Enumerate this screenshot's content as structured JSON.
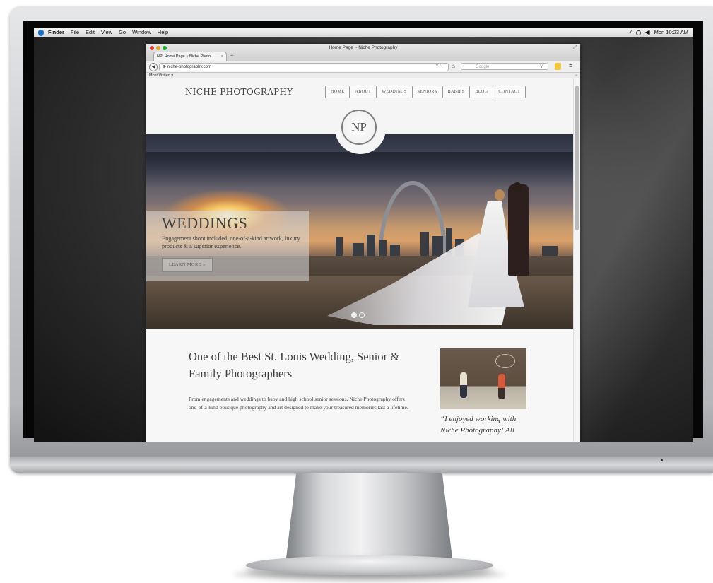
{
  "menubar": {
    "app": "Finder",
    "items": [
      "File",
      "Edit",
      "View",
      "Go",
      "Window",
      "Help"
    ],
    "clock": "Mon 10:23 AM"
  },
  "browser": {
    "window_title": "Home Page ~ Niche Photography",
    "tab_title": "Home Page ~ Niche Photo...",
    "tab_close": "×",
    "new_tab": "+",
    "url": "niche-photography.com",
    "search_placeholder": "Google",
    "bookmarks_label": "Most Visited ▾",
    "bookmarks_overflow": "»"
  },
  "site": {
    "logo": "NICHE PHOTOGRAPHY",
    "nav": [
      "HOME",
      "ABOUT",
      "WEDDINGS",
      "SENIORS",
      "BABIES",
      "BLOG",
      "CONTACT"
    ],
    "monogram": "NP",
    "hero": {
      "title": "WEDDINGS",
      "text": "Engagement shoot included, one-of-a-kind artwork, luxury products & a superior experience.",
      "cta": "LEARN MORE »",
      "slides": 2,
      "active_slide": 1
    },
    "headline": "One of the Best St. Louis Wedding, Senior & Family Photographers",
    "intro": "From engagements and weddings to baby and high school senior sessions, Niche Photography offers one-of-a-kind boutique photography and art designed to make your treasured memories last a lifetime.",
    "testimonial": "“I enjoyed working with Niche Photography!  All"
  },
  "colors": {
    "menubar": "#e6e6e6",
    "traffic_red": "#e0443e",
    "traffic_yellow": "#dea123",
    "traffic_green": "#1aab29",
    "page_bg": "#f7f7f7",
    "text": "#3d3d3d"
  },
  "icons": [
    "apple-icon",
    "back-icon",
    "globe-icon",
    "reload-icon",
    "home-icon",
    "search-icon",
    "bookmark-icon",
    "menu-icon"
  ]
}
